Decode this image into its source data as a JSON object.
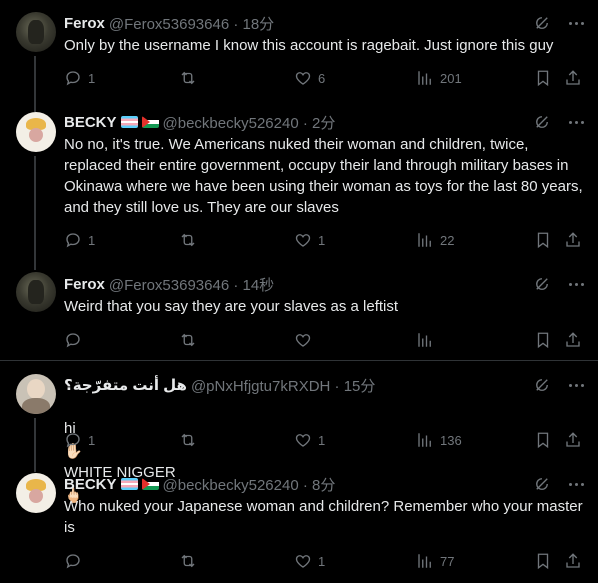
{
  "icons": {
    "reply": "reply-icon",
    "retweet": "retweet-icon",
    "like": "heart-icon",
    "views": "views-icon",
    "bookmark": "bookmark-icon",
    "share": "share-icon",
    "grok": "grok-icon",
    "more": "more-icon"
  },
  "colors": {
    "background": "#000000",
    "text": "#e7e9ea",
    "muted": "#71767b",
    "divider": "#2f3336"
  },
  "posts": [
    {
      "name": "Ferox",
      "handle_time": "@Ferox53693646 · 18分",
      "text": "Only by the username I know this account is ragebait. Just ignore this guy",
      "replies": "1",
      "retweets": "",
      "likes": "6",
      "views": "201"
    },
    {
      "name": "BECKY",
      "handle_time": "@beckbecky526240 · 2分",
      "text": "No no, it's true. We Americans nuked their woman and children, twice,\nreplaced their entire government, occupy their land through military bases in\nOkinawa where we have been using their woman as toys for the last 80 years,\nand they still love us. They are our slaves",
      "replies": "1",
      "retweets": "",
      "likes": "1",
      "views": "22"
    },
    {
      "name": "Ferox",
      "handle_time": "@Ferox53693646 · 14秒",
      "text": "Weird that you say they are your slaves as a leftist",
      "replies": "",
      "retweets": "",
      "likes": "",
      "views": ""
    },
    {
      "name": "هل أنت متفرّجة؟",
      "handle_time": "@pNxHfjgtu7kRXDH · 15分",
      "text_prefix": "hi",
      "emoji_1": "✋🏻",
      "text_middle": "WHITE NIGGER",
      "emoji_2": "🖕🏻",
      "replies": "1",
      "retweets": "",
      "likes": "1",
      "views": "136"
    },
    {
      "name": "BECKY",
      "handle_time": "@beckbecky526240 · 8分",
      "text": "Who nuked your Japanese woman and children? Remember who your master\nis",
      "replies": "",
      "retweets": "",
      "likes": "1",
      "views": "77"
    }
  ]
}
